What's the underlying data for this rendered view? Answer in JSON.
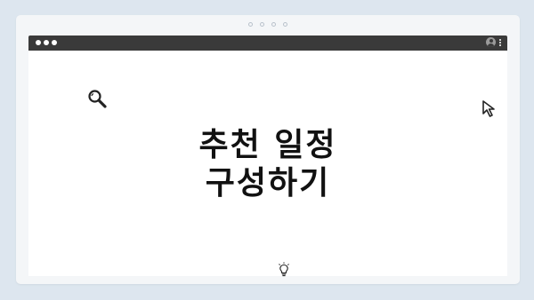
{
  "window": {
    "background": "#f4f6f8",
    "titlebar_color": "#3a3a3a"
  },
  "titlebar": {
    "controls": [
      "window-dot",
      "window-dot",
      "window-dot"
    ],
    "right_icons": [
      "profile-icon",
      "kebab-menu-icon"
    ]
  },
  "content": {
    "headline_line1": "추천 일정",
    "headline_line2": "구성하기",
    "icons": [
      "search-icon",
      "cursor-icon",
      "lightbulb-icon"
    ]
  }
}
